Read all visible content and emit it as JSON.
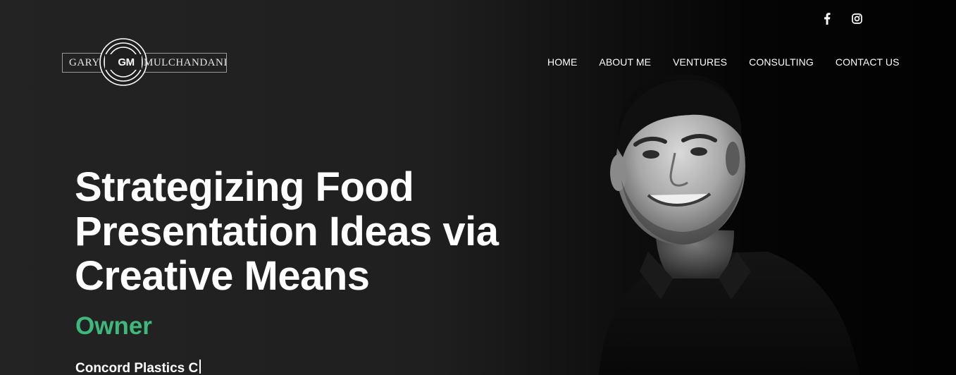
{
  "social": {
    "facebook_icon": "facebook-icon",
    "instagram_icon": "instagram-icon"
  },
  "logo": {
    "left_word": "GARY",
    "monogram": "GM",
    "right_word": "MULCHANDANI"
  },
  "nav": {
    "items": [
      {
        "label": "HOME"
      },
      {
        "label": "ABOUT ME"
      },
      {
        "label": "VENTURES"
      },
      {
        "label": "CONSULTING"
      },
      {
        "label": "CONTACT US"
      }
    ]
  },
  "hero": {
    "title_lines": [
      "Strategizing Food",
      "Presentation Ideas via",
      "Creative Means"
    ],
    "role": "Owner",
    "company": "Concord Plastics C"
  },
  "colors": {
    "accent": "#3fb87d",
    "background": "#1b1b1b",
    "text": "#ffffff"
  }
}
